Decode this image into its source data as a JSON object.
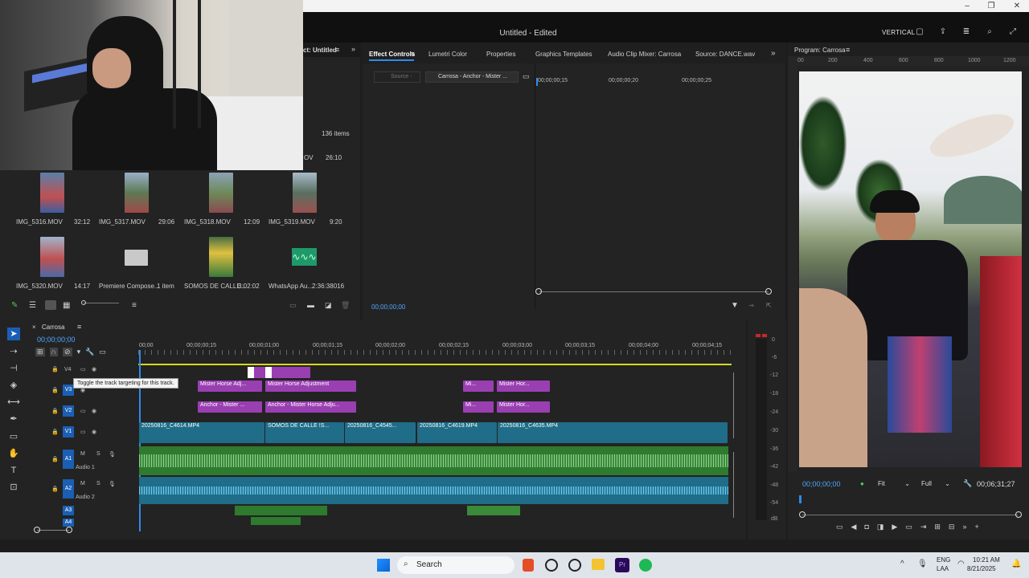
{
  "window": {
    "title": "Untitled - Edited",
    "workspace": "VERTICAL",
    "controls": [
      "–",
      "❐",
      "✕"
    ]
  },
  "project": {
    "tab": "ct: Untitled",
    "item_count": "136 items",
    "row0": {
      "name": "OV",
      "duration": "26:10"
    },
    "items": [
      {
        "name": "IMG_5316.MOV",
        "duration": "32:12"
      },
      {
        "name": "IMG_5317.MOV",
        "duration": "29:06"
      },
      {
        "name": "IMG_5318.MOV",
        "duration": "12:09"
      },
      {
        "name": "IMG_5319.MOV",
        "duration": "9:20"
      },
      {
        "name": "IMG_5320.MOV",
        "duration": "14:17"
      },
      {
        "name": "Premiere Compose...",
        "duration": "1 item"
      },
      {
        "name": "SOMOS DE CALLE...",
        "duration": "3:02:02"
      },
      {
        "name": "WhatsApp Au...",
        "duration": "2:36:38016"
      }
    ]
  },
  "effect_controls": {
    "tabs": [
      "Effect Controls",
      "Lumetri Color",
      "Properties",
      "Graphics Templates",
      "Audio Clip Mixer: Carrosa",
      "Source: DANCE.wav"
    ],
    "source_label": "Source -",
    "clip_label": "Carrosa - Anchor - Mister ...",
    "ruler": [
      "00;00;00;15",
      "00;00;00;20",
      "00;00;00;25"
    ],
    "timecode": "00;00;00;00"
  },
  "program": {
    "title": "Program: Carrosa",
    "timecode": "00;00;00;00",
    "fit": "Fit",
    "quality": "Full",
    "duration": "00;06;31;27",
    "ruler": [
      "00",
      "200",
      "400",
      "600",
      "800",
      "1000",
      "1200"
    ]
  },
  "timeline": {
    "sequence": "Carrosa",
    "timecode": "00;00;00;00",
    "ruler": [
      "00;00",
      "00;00;00;15",
      "00;00;01;00",
      "00;00;01;15",
      "00;00;02;00",
      "00;00;02;15",
      "00;00;03;00",
      "00;00;03;15",
      "00;00;04;00",
      "00;00;04;15"
    ],
    "tooltip": "Toggle the track targeting for this track.",
    "tracks": {
      "v4": "V4",
      "v3": "V3",
      "v2": "V2",
      "v1": "V1",
      "a1": "A1",
      "a2": "A2",
      "a3": "A3",
      "a4": "A4",
      "a1_name": "Audio 1",
      "a2_name": "Audio 2"
    },
    "clips": {
      "v3a": "Mister Horse Adj...",
      "v3b": "Mister Horse Adjustment",
      "v3c": "Mi...",
      "v3d": "Mister Hor...",
      "v2a": "Anchor - Mister ...",
      "v2b": "Anchor - Mister Horse Adju...",
      "v2c": "Mi...",
      "v2d": "Mister Hor...",
      "v1a": "20250816_C4614.MP4",
      "v1b": "SOMOS DE CALLE !S...",
      "v1c": "20250816_C4545...",
      "v1d": "20250816_C4619.MP4",
      "v1e": "20250816_C4635.MP4"
    },
    "meter": [
      "0",
      "-6",
      "-12",
      "-18",
      "-24",
      "-30",
      "-36",
      "-42",
      "-48",
      "-54",
      "dB"
    ]
  },
  "taskbar": {
    "search": "Search",
    "lang1": "ENG",
    "lang2": "LAA",
    "time": "10:21 AM",
    "date": "8/21/2025"
  }
}
